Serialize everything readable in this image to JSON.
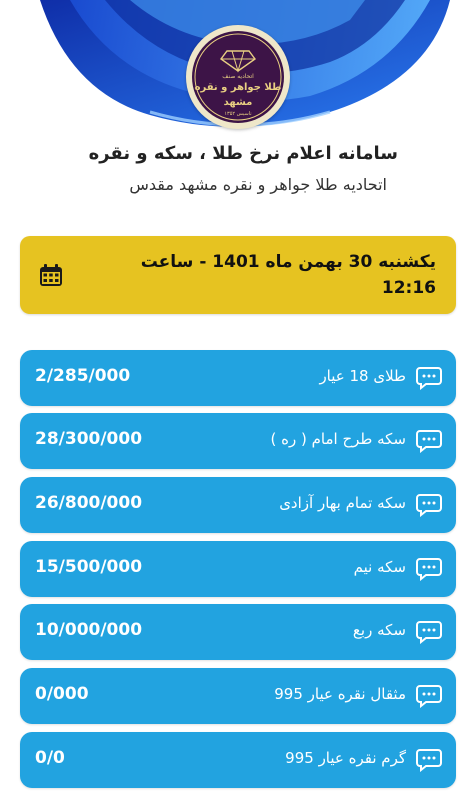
{
  "header": {
    "title": "سامانه اعلام نرخ طلا ، سکه و نقره",
    "subtitle": "اتحادیه طلا جواهر و نقره مشهد مقدس"
  },
  "logo": {
    "line1": "اتحادیه صنف",
    "line2": "طلا جواهر و نقره",
    "line3": "مشهد",
    "line4": "تاسیس ۱۳۵۲"
  },
  "date_card": {
    "text": "یکشنبه 30 بهمن ماه 1401 - ساعت 12:16",
    "icon": "calendar-icon"
  },
  "prices": [
    {
      "label": "طلای 18 عیار",
      "value": "2/285/000",
      "icon": "chat-icon"
    },
    {
      "label": "سکه طرح امام ( ره )",
      "value": "28/300/000",
      "icon": "chat-icon"
    },
    {
      "label": "سکه تمام بهار آزادی",
      "value": "26/800/000",
      "icon": "chat-icon"
    },
    {
      "label": "سکه نیم",
      "value": "15/500/000",
      "icon": "chat-icon"
    },
    {
      "label": "سکه ربع",
      "value": "10/000/000",
      "icon": "chat-icon"
    },
    {
      "label": "مثقال نقره عیار 995",
      "value": "0/000",
      "icon": "chat-icon"
    },
    {
      "label": "گرم نقره عیار 995",
      "value": "0/0",
      "icon": "chat-icon"
    }
  ],
  "colors": {
    "hero_blue": "#1b4fd6",
    "date_card": "#e6c321",
    "price_row": "#22a3e0",
    "logo_purple": "#3d1447",
    "logo_gold": "#e8cf82"
  }
}
